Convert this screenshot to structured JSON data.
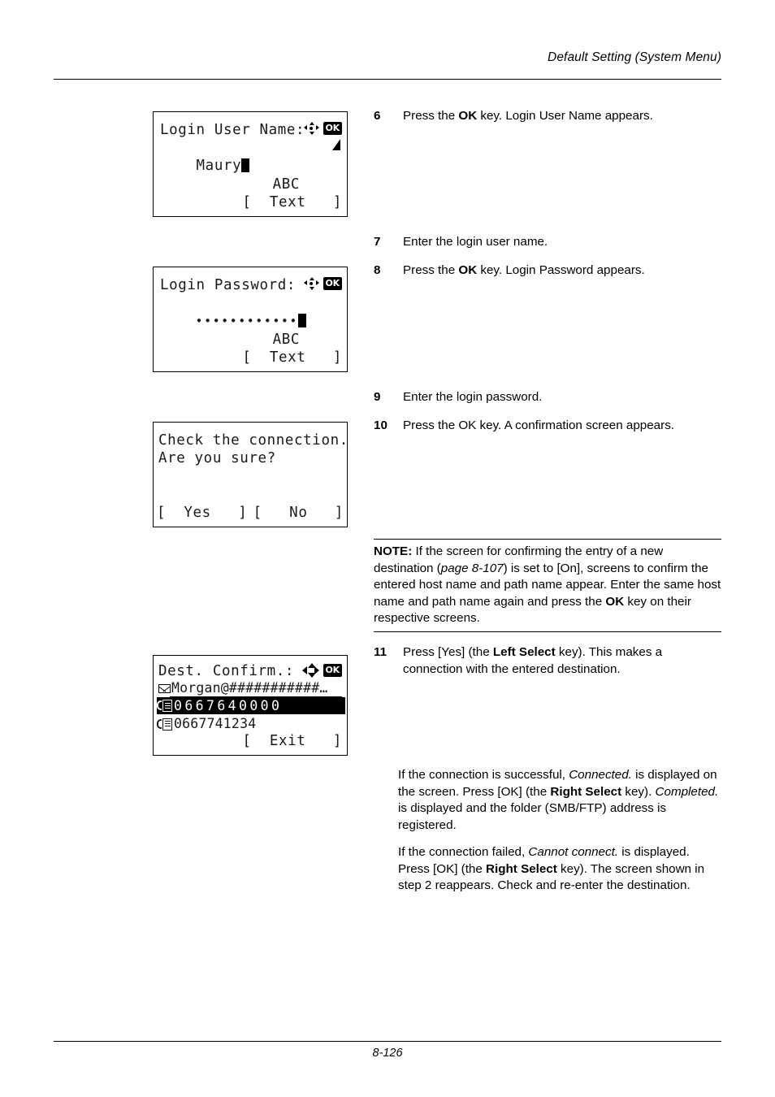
{
  "header": {
    "running_title": "Default Setting (System Menu)"
  },
  "footer": {
    "page_number": "8-126"
  },
  "screens": {
    "login_user_name": {
      "title": "Login User Name:",
      "value": "Maury",
      "mode_label": "ABC",
      "soft_key": "[  Text   ]",
      "nav_icon": "four-way-arrow-icon",
      "ok_icon": "OK"
    },
    "login_password": {
      "title": "Login Password:",
      "value": "••••••••••••",
      "mode_label": "ABC",
      "soft_key": "[  Text   ]",
      "nav_icon": "four-way-arrow-icon",
      "ok_icon": "OK"
    },
    "check_connection": {
      "line1": "Check the connection.",
      "line2": "Are you sure?",
      "soft_key_left": "[  Yes   ]",
      "soft_key_right": "[   No   ]"
    },
    "dest_confirm": {
      "title": "Dest. Confirm.:",
      "nav_icon": "four-way-arrow-icon",
      "ok_icon": "OK",
      "rows": [
        {
          "icon": "email-icon",
          "text": "Morgan@###########…",
          "selected": false
        },
        {
          "icon": "fax-icon",
          "text": "0667640000",
          "selected": true
        },
        {
          "icon": "fax-icon",
          "text": "0667741234",
          "selected": false
        }
      ],
      "soft_key": "[  Exit   ]"
    }
  },
  "steps": [
    {
      "number": "6",
      "text_pre": "Press the ",
      "bold": "OK",
      "text_post": " key. Login User Name appears."
    },
    {
      "number": "7",
      "text_pre": "Enter the login user name.",
      "bold": "",
      "text_post": ""
    },
    {
      "number": "8",
      "text_pre": "Press the ",
      "bold": "OK",
      "text_post": " key. Login Password appears."
    },
    {
      "number": "9",
      "text_pre": "Enter the login password.",
      "bold": "",
      "text_post": ""
    },
    {
      "number": "10",
      "text_pre": "Press the OK key. A confirmation screen appears.",
      "bold": "",
      "text_post": ""
    },
    {
      "number": "11",
      "text_pre": "Press [Yes] (the ",
      "bold": "Left Select",
      "text_post": " key). This makes a connection with the entered destination."
    }
  ],
  "note": {
    "label": "NOTE:",
    "part1": " If the screen for confirming the entry of a new destination (",
    "ref": "page 8-107",
    "part2": ") is set to [On], screens to confirm the entered host name and path name appear. Enter the same host name and path name again and press the ",
    "bold_key": "OK",
    "part3": " key on their respective screens."
  },
  "paragraphs": {
    "success": {
      "p1": "If the connection is successful, ",
      "em1": "Connected.",
      "p2": " is displayed on the screen. Press [OK] (the ",
      "b1": "Right Select",
      "p3": " key). ",
      "em2": "Completed.",
      "p4": " is displayed and the folder (SMB/FTP) address is registered."
    },
    "failure": {
      "p1": "If the connection failed, ",
      "em1": "Cannot connect.",
      "p2": " is displayed. Press [OK] (the ",
      "b1": "Right Select",
      "p3": " key). The screen shown in step 2 reappears. Check and re-enter the destination."
    }
  }
}
